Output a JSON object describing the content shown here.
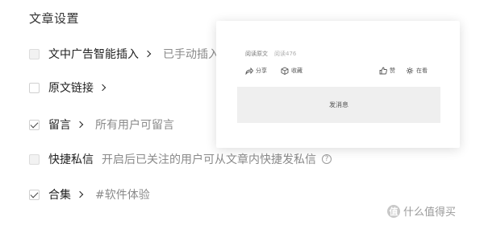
{
  "title": "文章设置",
  "rows": [
    {
      "label": "文中广告智能插入",
      "desc": "已手动插入",
      "checked": false,
      "disabled": true
    },
    {
      "label": "原文链接",
      "desc": "",
      "checked": false,
      "disabled": false
    },
    {
      "label": "留言",
      "desc": "所有用户可留言",
      "checked": true,
      "disabled": false
    },
    {
      "label": "快捷私信",
      "desc": "开启后已关注的用户可从文章内快捷发私信",
      "checked": false,
      "disabled": true
    },
    {
      "label": "合集",
      "desc": "#软件体验",
      "checked": true,
      "disabled": false
    }
  ],
  "popup": {
    "read_original": "阅读原文",
    "read_count": "阅读476",
    "share": "分享",
    "favorite": "收藏",
    "like": "赞",
    "watching": "在看",
    "send_message": "发消息"
  },
  "watermark": {
    "logo_char": "值",
    "text": "什么值得买"
  }
}
